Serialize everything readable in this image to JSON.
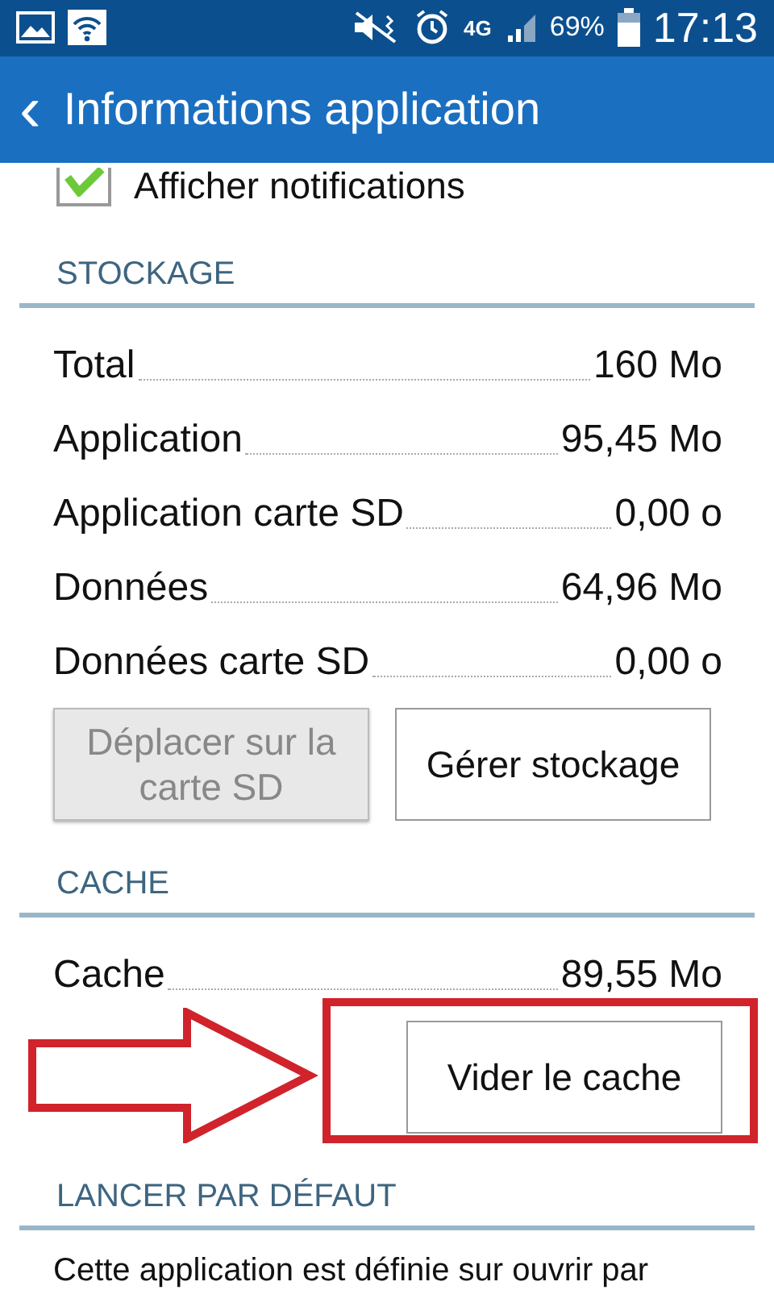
{
  "status_bar": {
    "network": "4G",
    "battery": "69%",
    "time": "17:13"
  },
  "header": {
    "back": "‹",
    "title": "Informations application"
  },
  "notifications": {
    "label": "Afficher notifications",
    "checked": true
  },
  "sections": [
    {
      "title": "STOCKAGE",
      "rows": [
        {
          "label": "Total",
          "value": "160 Mo"
        },
        {
          "label": "Application",
          "value": "95,45 Mo"
        },
        {
          "label": "Application carte SD",
          "value": "0,00 o"
        },
        {
          "label": "Données",
          "value": "64,96 Mo"
        },
        {
          "label": "Données carte SD",
          "value": "0,00 o"
        }
      ],
      "buttons": [
        {
          "label": "Déplacer sur la carte SD",
          "disabled": true,
          "highlighted": false
        },
        {
          "label": "Gérer stockage",
          "disabled": false,
          "highlighted": false
        }
      ]
    },
    {
      "title": "CACHE",
      "rows": [
        {
          "label": "Cache",
          "value": "89,55 Mo"
        }
      ],
      "buttons": [
        {
          "label": "Vider le cache",
          "disabled": false,
          "highlighted": true
        }
      ]
    },
    {
      "title": "LANCER PAR DÉFAUT",
      "text": "Cette application est définie sur ouvrir par"
    }
  ]
}
